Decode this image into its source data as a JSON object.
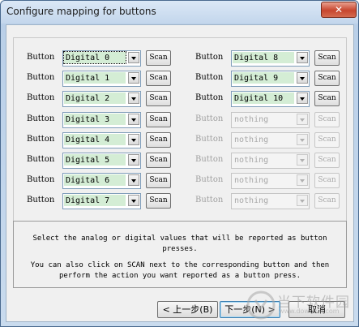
{
  "window": {
    "title": "Configure mapping for buttons",
    "close_glyph": "✕"
  },
  "mapping": {
    "left_column": [
      {
        "label": "Button",
        "value": "Digital 0",
        "scan": "Scan"
      },
      {
        "label": "Button",
        "value": "Digital 1",
        "scan": "Scan"
      },
      {
        "label": "Button",
        "value": "Digital 2",
        "scan": "Scan"
      },
      {
        "label": "Button",
        "value": "Digital 3",
        "scan": "Scan"
      },
      {
        "label": "Button",
        "value": "Digital 4",
        "scan": "Scan"
      },
      {
        "label": "Button",
        "value": "Digital 5",
        "scan": "Scan"
      },
      {
        "label": "Button",
        "value": "Digital 6",
        "scan": "Scan"
      },
      {
        "label": "Button",
        "value": "Digital 7",
        "scan": "Scan"
      }
    ],
    "right_column": [
      {
        "label": "Button",
        "value": "Digital 8",
        "scan": "Scan"
      },
      {
        "label": "Button",
        "value": "Digital 9",
        "scan": "Scan"
      },
      {
        "label": "Button",
        "value": "Digital 10",
        "scan": "Scan"
      },
      {
        "label": "Button",
        "value": "nothing",
        "scan": "Scan"
      },
      {
        "label": "Button",
        "value": "nothing",
        "scan": "Scan"
      },
      {
        "label": "Button",
        "value": "nothing",
        "scan": "Scan"
      },
      {
        "label": "Button",
        "value": "nothing",
        "scan": "Scan"
      },
      {
        "label": "Button",
        "value": "nothing",
        "scan": "Scan"
      }
    ]
  },
  "info": {
    "line1": "Select the analog or digital values that will be reported as button",
    "line2": "presses.",
    "line3": "You can also click on SCAN next to the corresponding button and then",
    "line4": "perform the action you want reported as a button press."
  },
  "footer": {
    "back_label": "< 上一步(B)",
    "next_label": "下一步(N) >",
    "cancel_label": "取消"
  },
  "watermark": {
    "text_cn": "当下软件园",
    "text_en": "www.downxia.com"
  },
  "colors": {
    "combo_fill": "#d4edd5",
    "title_bar": "#c3d6ec",
    "close_button": "#c7452d"
  }
}
